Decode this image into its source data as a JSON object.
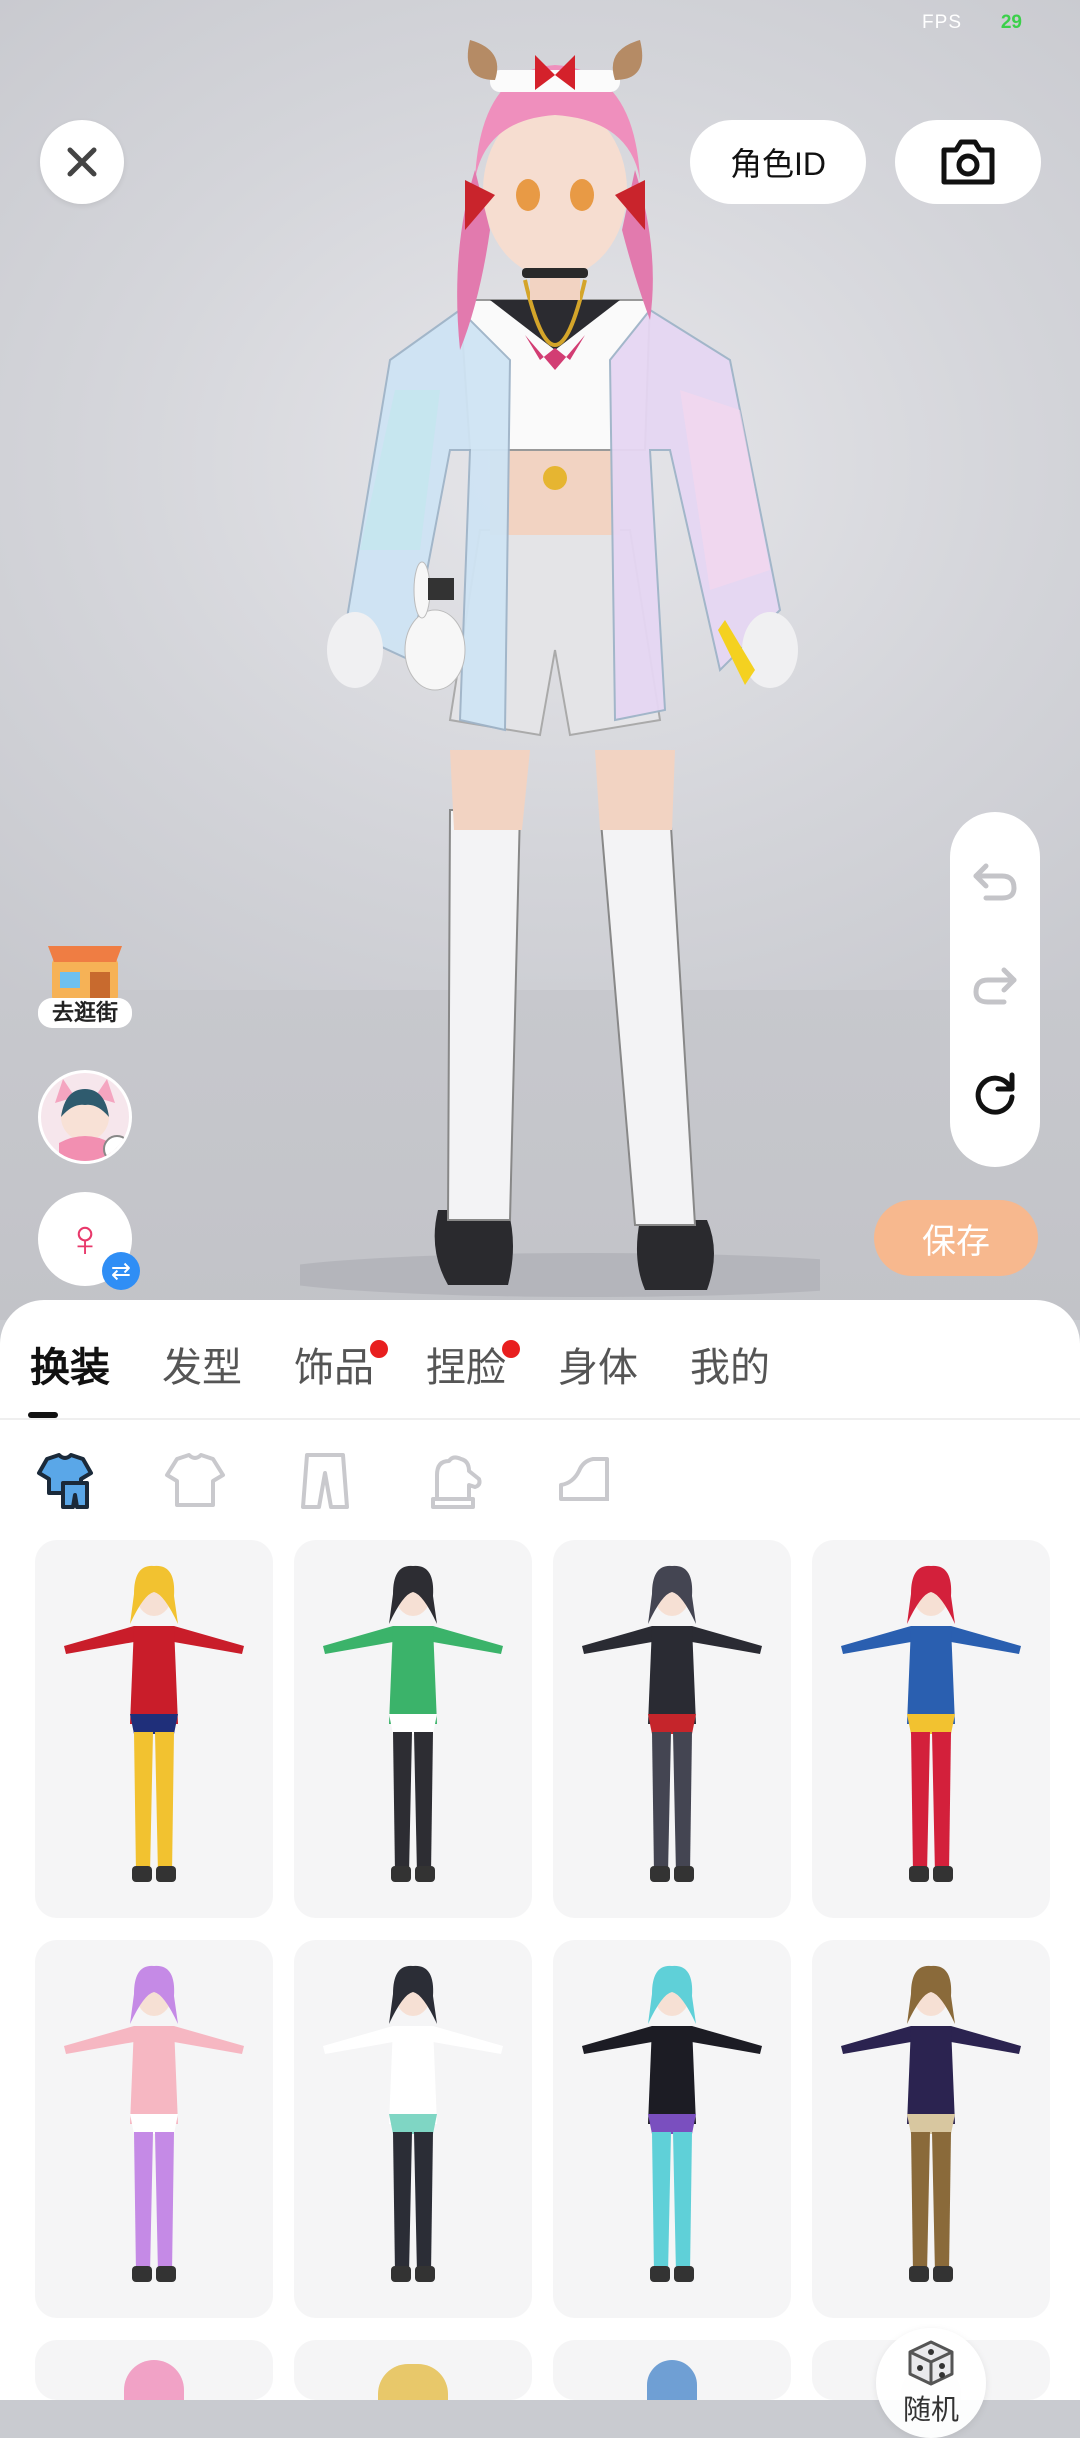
{
  "status": {
    "fps_label": "FPS",
    "fps_value": "29"
  },
  "header": {
    "role_id_label": "角色ID",
    "close_icon": "close-icon",
    "camera_icon": "camera-icon"
  },
  "history": {
    "undo_icon": "undo-icon",
    "redo_icon": "redo-icon",
    "reset_icon": "reset-icon"
  },
  "save_label": "保存",
  "side": {
    "street_label": "去逛街",
    "gender_symbol": "♀"
  },
  "tabs": [
    {
      "label": "换装",
      "active": true,
      "badge": false
    },
    {
      "label": "发型",
      "active": false,
      "badge": false
    },
    {
      "label": "饰品",
      "active": false,
      "badge": true
    },
    {
      "label": "捏脸",
      "active": false,
      "badge": true
    },
    {
      "label": "身体",
      "active": false,
      "badge": false
    },
    {
      "label": "我的",
      "active": false,
      "badge": false
    }
  ],
  "categories": [
    "outfit-set-icon",
    "top-icon",
    "pants-icon",
    "gloves-icon",
    "shoes-icon"
  ],
  "outfits": [
    {
      "name": "wonder-woman-outfit",
      "colors": [
        "#c91d2a",
        "#f2c230",
        "#1f2f7a"
      ]
    },
    {
      "name": "green-kimono-outfit",
      "colors": [
        "#3bb36a",
        "#2d2d33",
        "#ffffff"
      ]
    },
    {
      "name": "black-widow-outfit",
      "colors": [
        "#2a2b33",
        "#444552",
        "#c5252b"
      ]
    },
    {
      "name": "captain-marvel-outfit",
      "colors": [
        "#2a5fb0",
        "#d3203b",
        "#f2c230"
      ]
    },
    {
      "name": "pink-cat-costume",
      "colors": [
        "#f6b7c2",
        "#c58ae6",
        "#ffffff"
      ]
    },
    {
      "name": "sporty-casual-outfit",
      "colors": [
        "#ffffff",
        "#2b2d36",
        "#7fd6c4"
      ]
    },
    {
      "name": "gothic-dress-outfit",
      "colors": [
        "#1c1c24",
        "#5fd0d8",
        "#7a4fbf"
      ]
    },
    {
      "name": "wizard-robe-outfit",
      "colors": [
        "#2b2350",
        "#8a6a3a",
        "#d8c7a0"
      ]
    }
  ],
  "random_label": "随机"
}
